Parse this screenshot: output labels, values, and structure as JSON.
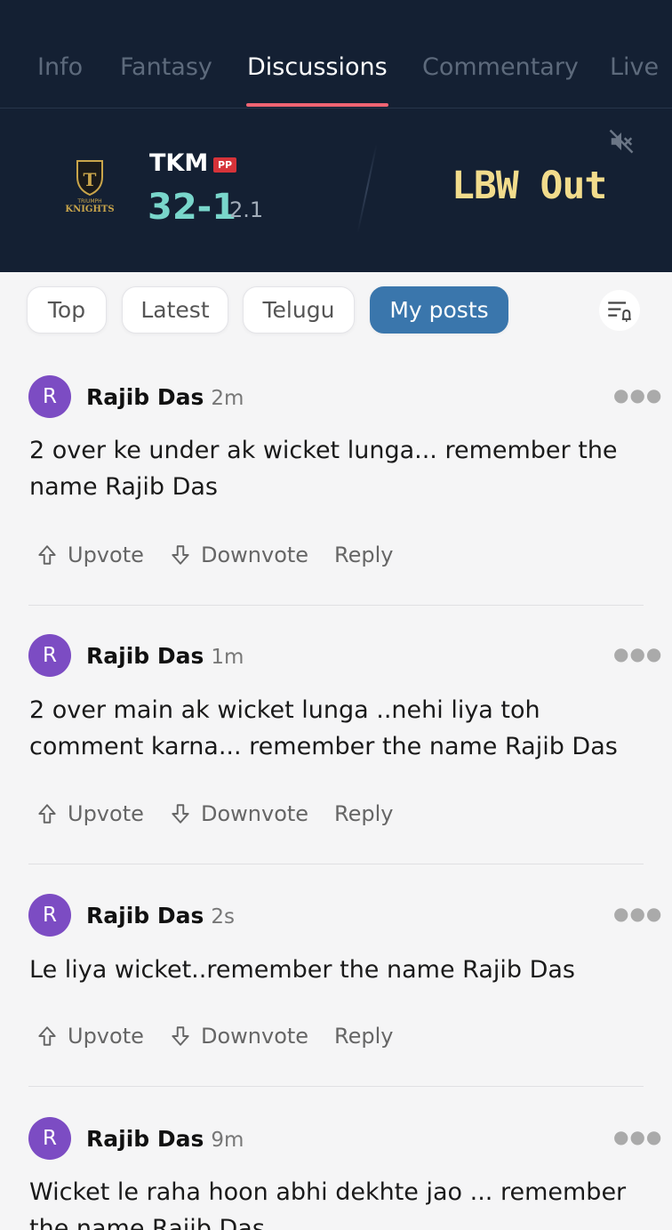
{
  "tabs": [
    {
      "label": "Info"
    },
    {
      "label": "Fantasy"
    },
    {
      "label": "Discussions"
    },
    {
      "label": "Commentary"
    },
    {
      "label": "Live"
    }
  ],
  "scoreboard": {
    "team": "TKM",
    "badge": "PP",
    "score": "32-1",
    "overs": "2.1",
    "event": "LBW Out",
    "logo_line1": "TRIUMPH",
    "logo_line2": "KNIGHTS"
  },
  "filters": [
    {
      "label": "Top"
    },
    {
      "label": "Latest"
    },
    {
      "label": "Telugu"
    },
    {
      "label": "My posts"
    }
  ],
  "posts": [
    {
      "initial": "R",
      "author": "Rajib Das",
      "time": "2m",
      "text": "2 over ke under ak wicket lunga... remember the name Rajib Das"
    },
    {
      "initial": "R",
      "author": "Rajib Das",
      "time": "1m",
      "text": "2 over main ak wicket lunga ..nehi liya toh comment karna... remember the name Rajib Das"
    },
    {
      "initial": "R",
      "author": "Rajib Das",
      "time": "2s",
      "text": "Le liya wicket..remember the name Rajib Das"
    },
    {
      "initial": "R",
      "author": "Rajib Das",
      "time": "9m",
      "text": "Wicket le raha hoon abhi dekhte jao ... remember the name Rajib Das"
    }
  ],
  "actions": {
    "upvote": "Upvote",
    "downvote": "Downvote",
    "reply": "Reply"
  },
  "colors": {
    "header_bg": "#142033",
    "tab_indicator": "#ef6473",
    "score": "#79d6cb",
    "event": "#f2dc8c",
    "active_chip": "#3a76ac",
    "avatar": "#7c4cc3"
  }
}
